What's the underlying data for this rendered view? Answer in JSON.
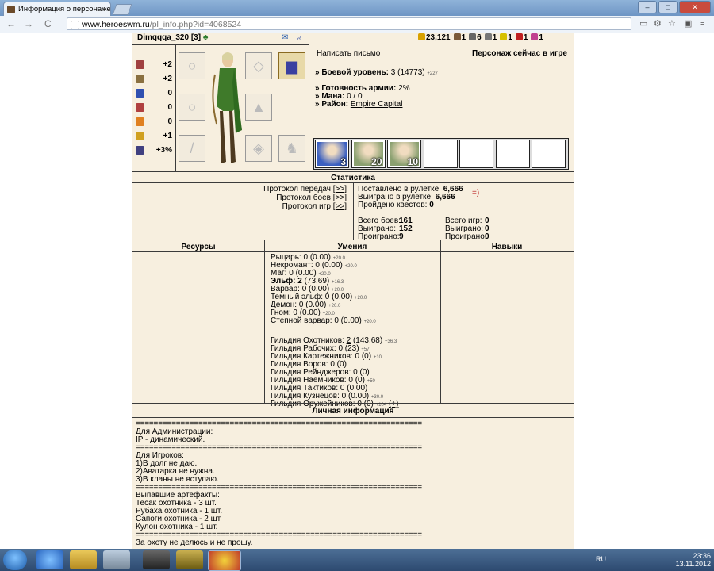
{
  "browser": {
    "tab_title": "Информация о персонаже",
    "tab_close": "×",
    "window_buttons": [
      "–",
      "□",
      "✕"
    ],
    "url_host": "www.heroeswm.ru",
    "url_path": "/pl_info.php?id=4068524",
    "nav_back": "←",
    "nav_forward": "→",
    "nav_reload": "C",
    "icons": [
      "page-icon",
      "zoom-icon",
      "star-icon",
      "extension-icon"
    ]
  },
  "header": {
    "player_name": "Dimqqqa_320",
    "player_level": "[3]",
    "gender_icon": "♂",
    "resources": [
      {
        "icon": "gold-icon",
        "value": "23,121",
        "color": "#d8a100"
      },
      {
        "icon": "wood-icon",
        "value": "1",
        "color": "#7a5a3a"
      },
      {
        "icon": "ore-icon",
        "value": "6",
        "color": "#666666"
      },
      {
        "icon": "mercury-icon",
        "value": "1",
        "color": "#777777"
      },
      {
        "icon": "sulfur-icon",
        "value": "1",
        "color": "#d6c000"
      },
      {
        "icon": "crystal-icon",
        "value": "1",
        "color": "#c02020"
      },
      {
        "icon": "gems-icon",
        "value": "1",
        "color": "#c04090"
      }
    ]
  },
  "stats": [
    {
      "icon": "attack-icon",
      "color": "#a04040",
      "value": "+2"
    },
    {
      "icon": "defense-icon",
      "color": "#8a7040",
      "value": "+2"
    },
    {
      "icon": "spellpower-icon",
      "color": "#3050b0",
      "value": "0"
    },
    {
      "icon": "knowledge-icon",
      "color": "#b04040",
      "value": "0"
    },
    {
      "icon": "luck-icon",
      "color": "#e08020",
      "value": "0"
    },
    {
      "icon": "morale-icon",
      "color": "#d0a020",
      "value": "+1"
    },
    {
      "icon": "initiative-icon",
      "color": "#404080",
      "value": "+3%"
    }
  ],
  "info": {
    "write_letter": "Написать письмо",
    "online_status": "Персонаж сейчас в игре",
    "combat_level_label": "Боевой уровень:",
    "combat_level": "3",
    "combat_exp": "(14773)",
    "combat_exp_gain": "+227",
    "army_ready_label": "Готовность армии:",
    "army_ready": "2%",
    "mana_label": "Мана:",
    "mana": "0 / 0",
    "district_label": "Район:",
    "district": "Empire Capital",
    "bullet": "»"
  },
  "army": [
    {
      "count": "3",
      "color": "#3a5fc0"
    },
    {
      "count": "20",
      "color": "#8aa070"
    },
    {
      "count": "10",
      "color": "#8aa070"
    },
    {
      "count": "",
      "color": ""
    },
    {
      "count": "",
      "color": ""
    },
    {
      "count": "",
      "color": ""
    },
    {
      "count": "",
      "color": ""
    }
  ],
  "statistics": {
    "title": "Статистика",
    "protocols": [
      {
        "label": "Протокол передач",
        "link": "[>>]"
      },
      {
        "label": "Протокол боев",
        "link": "[>>]"
      },
      {
        "label": "Протокол игр",
        "link": "[>>]"
      }
    ],
    "roulette_bet_label": "Поставлено в рулетке:",
    "roulette_bet": "6,666",
    "roulette_smile": "=)",
    "roulette_won_label": "Выиграно в рулетке:",
    "roulette_won": "6,666",
    "quests_label": "Пройдено квестов:",
    "quests": "0",
    "battles": [
      {
        "label": "Всего боев:",
        "value": "161"
      },
      {
        "label": "Выиграно:",
        "value": "152"
      },
      {
        "label": "Проиграно:",
        "value": "9"
      }
    ],
    "games": [
      {
        "label": "Всего игр:",
        "value": "0"
      },
      {
        "label": "Выиграно:",
        "value": "0"
      },
      {
        "label": "Проиграно:",
        "value": "0"
      }
    ]
  },
  "columns": {
    "resources": "Ресурсы",
    "skills": "Умения",
    "perks": "Навыки"
  },
  "skills": {
    "factions": [
      {
        "name": "Рыцарь:",
        "lvl": "0",
        "val": "(0.00)",
        "gain": "+20.0",
        "bold": false
      },
      {
        "name": "Некромант:",
        "lvl": "0",
        "val": "(0.00)",
        "gain": "+20.0",
        "bold": false
      },
      {
        "name": "Маг:",
        "lvl": "0",
        "val": "(0.00)",
        "gain": "+20.0",
        "bold": false
      },
      {
        "name": "Эльф:",
        "lvl": "2",
        "val": "(73.69)",
        "gain": "+16.3",
        "bold": true
      },
      {
        "name": "Варвар:",
        "lvl": "0",
        "val": "(0.00)",
        "gain": "+20.0",
        "bold": false
      },
      {
        "name": "Темный эльф:",
        "lvl": "0",
        "val": "(0.00)",
        "gain": "+20.0",
        "bold": false
      },
      {
        "name": "Демон:",
        "lvl": "0",
        "val": "(0.00)",
        "gain": "+20.0",
        "bold": false
      },
      {
        "name": "Гном:",
        "lvl": "0",
        "val": "(0.00)",
        "gain": "+20.0",
        "bold": false
      },
      {
        "name": "Степной варвар:",
        "lvl": "0",
        "val": "(0.00)",
        "gain": "+20.0",
        "bold": false
      }
    ],
    "guilds": [
      {
        "name": "Гильдия Охотников:",
        "lvl": "2",
        "val": "(143.68)",
        "gain": "+36.3",
        "link": true
      },
      {
        "name": "Гильдия Рабочих:",
        "lvl": "0",
        "val": "(23)",
        "gain": "+57",
        "link": false
      },
      {
        "name": "Гильдия Картежников:",
        "lvl": "0",
        "val": "(0)",
        "gain": "+10",
        "link": false
      },
      {
        "name": "Гильдия Воров:",
        "lvl": "0",
        "val": "(0)",
        "gain": "",
        "link": false
      },
      {
        "name": "Гильдия Рейнджеров:",
        "lvl": "0",
        "val": "(0)",
        "gain": "",
        "link": false
      },
      {
        "name": "Гильдия Наемников:",
        "lvl": "0",
        "val": "(0)",
        "gain": "+50",
        "link": false
      },
      {
        "name": "Гильдия Тактиков:",
        "lvl": "0",
        "val": "(0.00)",
        "gain": "",
        "link": false
      },
      {
        "name": "Гильдия Кузнецов:",
        "lvl": "0",
        "val": "(0.00)",
        "gain": "+30.0",
        "link": false
      },
      {
        "name": "Гильдия Оружейников:",
        "lvl": "0",
        "val": "(0)",
        "gain": "+104",
        "link": false
      }
    ],
    "plus_link": "(+)"
  },
  "personal": {
    "title": "Личная информация",
    "separator": "================================================================",
    "lines": [
      "sep",
      "Для Администрации:",
      "IP - динамический.",
      "sep",
      "Для Игроков:",
      "1)В долг не даю.",
      "2)Аватарка не нужна.",
      "3)В кланы не вступаю.",
      "sep",
      "Выпавшие артефакты:",
      "Тесак охотника - 3 шт.",
      "Рубаха охотника - 1 шт.",
      "Сапоги охотника - 2 шт.",
      "Кулон охотника - 1 шт.",
      "sep",
      "За охоту не делюсь и не прошу."
    ]
  },
  "taskbar": {
    "lang": "RU",
    "time": "23:36",
    "date": "13.11.2012"
  }
}
